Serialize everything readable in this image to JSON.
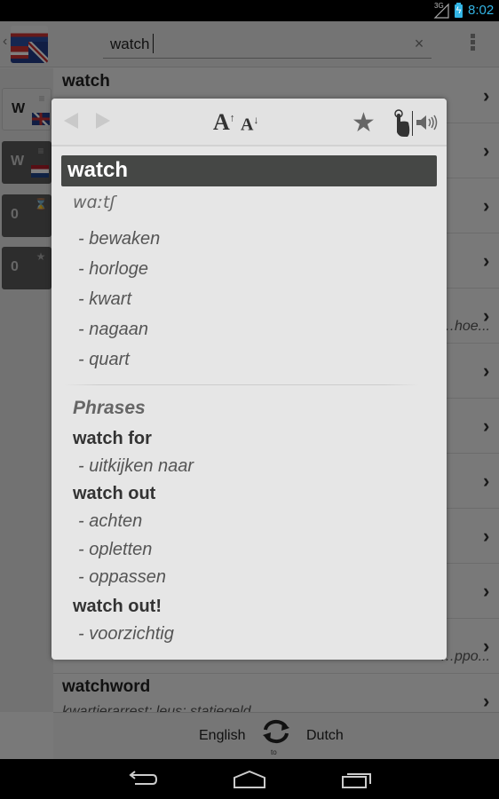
{
  "status_bar": {
    "network": "3G",
    "time": "8:02",
    "accent_color": "#33b5e5"
  },
  "action_bar": {
    "search_value": "watch",
    "clear_icon": "×"
  },
  "side_tabs": [
    {
      "label": "W",
      "icon": "abc",
      "flag": "uk",
      "active": true
    },
    {
      "label": "W",
      "icon": "abc",
      "flag": "nl",
      "active": false
    },
    {
      "label": "0",
      "icon": "history",
      "active": false
    },
    {
      "label": "0",
      "icon": "★",
      "active": false
    }
  ],
  "results": [
    {
      "word": "watch",
      "translation": "bewaken; horloge; kwart; nagaan; quart"
    },
    {
      "word": "",
      "translation": ""
    },
    {
      "word": "",
      "translation": ""
    },
    {
      "word": "",
      "translation": ""
    },
    {
      "word": "",
      "translation": "…hoe..."
    },
    {
      "word": "",
      "translation": ""
    },
    {
      "word": "",
      "translation": ""
    },
    {
      "word": "",
      "translation": ""
    },
    {
      "word": "",
      "translation": ""
    },
    {
      "word": "",
      "translation": ""
    },
    {
      "word": "",
      "translation": "…ppo..."
    },
    {
      "word": "watchword",
      "translation": "kwartierarrest; leus; statiegeld"
    }
  ],
  "lang_bar": {
    "from": "English",
    "to_label": "to",
    "to": "Dutch"
  },
  "dialog": {
    "headword": "watch",
    "phonetic": "wɑːtʃ",
    "meanings": [
      "- bewaken",
      "- horloge",
      "- kwart",
      "- nagaan",
      "- quart"
    ],
    "section_title": "Phrases",
    "phrases": [
      {
        "phrase": "watch for",
        "meanings": [
          "- uitkijken naar"
        ]
      },
      {
        "phrase": "watch out",
        "meanings": [
          "- achten",
          "- opletten",
          "- oppassen"
        ]
      },
      {
        "phrase": "watch out!",
        "meanings": [
          "- voorzichtig"
        ]
      }
    ]
  }
}
